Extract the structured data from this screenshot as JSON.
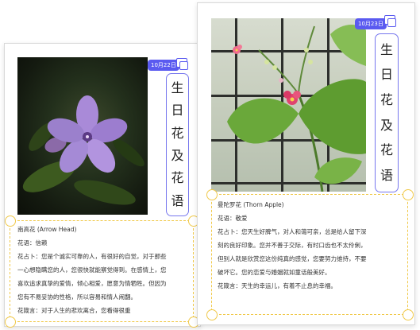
{
  "cards": {
    "left": {
      "date": "10月22日",
      "title_chars": [
        "生",
        "日",
        "花",
        "及",
        "花",
        "语"
      ],
      "lines": [
        "南高花 (Arrow Head)",
        "花语：信赖",
        "花占卜：您是个诚实可靠的人，有很好的自觉，对于那些",
        "一心想隐瞒您的人，您很快就能察觉得到。在感情上，您",
        "喜欢追求真挚的爱情，倾心相爱，愿意为情牺牲。但因为",
        "您有不易妥协的性格，所以容易和情人闹翻。",
        "花箴言：对于人生的悲欢离合，您看得很重"
      ]
    },
    "right": {
      "date": "10月23日",
      "title_chars": [
        "生",
        "日",
        "花",
        "及",
        "花",
        "语"
      ],
      "lines": [
        "曼陀罗花 (Thorn Apple)",
        "花语：敬爱",
        "花占卜：您天生好脾气，对人和蔼可亲，总是给人留下深",
        "刻的良好印象。您并不善于交际，有时口齿也不太伶俐，",
        "但别人就是欣赏您这份纯真的感觉，您要努力维持，不要",
        "破坏它。您的恋爱与婚姻就如童话般美好。",
        "花箴言：天生的幸运儿，有着不止息的幸福。"
      ]
    }
  },
  "colors": {
    "accent": "#5a5af0",
    "dashed_border": "#f0c94a",
    "petal_purple": "#a98ad8",
    "petal_pink": "#e0436e"
  },
  "icons": {
    "date_icon": "calendar-copy-icon"
  }
}
